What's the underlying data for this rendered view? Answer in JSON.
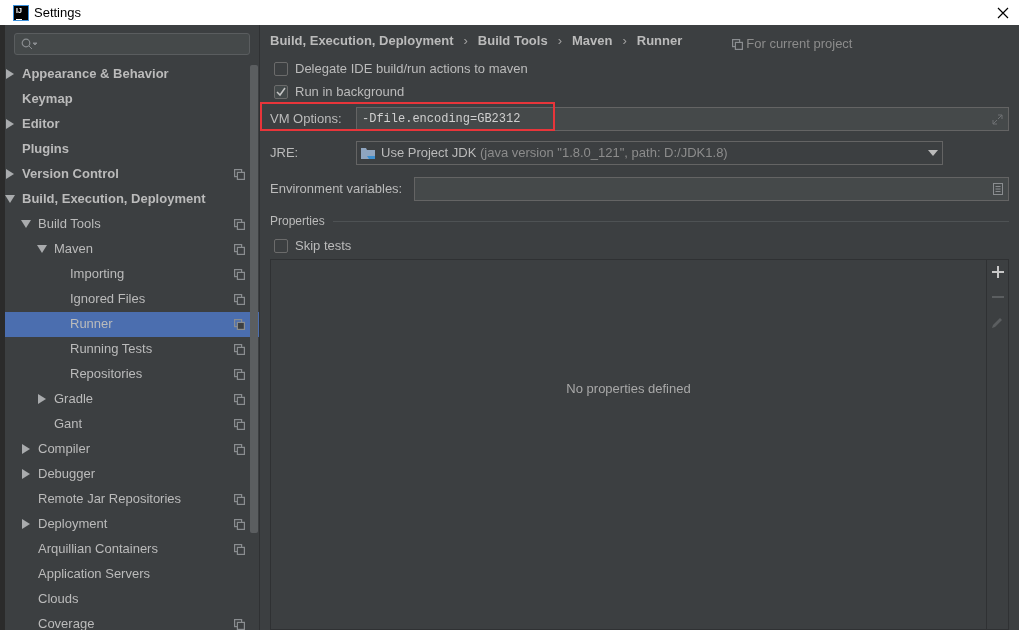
{
  "window": {
    "title": "Settings",
    "logo": "IJ"
  },
  "tree": [
    {
      "label": "Appearance & Behavior",
      "expanded": false,
      "shared": false,
      "selected": false
    },
    {
      "label": "Keymap",
      "shared": false,
      "selected": false
    },
    {
      "label": "Editor",
      "expanded": false,
      "shared": false,
      "selected": false
    },
    {
      "label": "Plugins",
      "shared": false,
      "selected": false
    },
    {
      "label": "Version Control",
      "expanded": false,
      "shared": true,
      "selected": false
    },
    {
      "label": "Build, Execution, Deployment",
      "expanded": true,
      "shared": false,
      "selected": false,
      "children": [
        {
          "label": "Build Tools",
          "expanded": true,
          "shared": true,
          "selected": false,
          "children": [
            {
              "label": "Maven",
              "expanded": true,
              "shared": true,
              "selected": false,
              "children": [
                {
                  "label": "Importing",
                  "shared": true,
                  "selected": false
                },
                {
                  "label": "Ignored Files",
                  "shared": true,
                  "selected": false
                },
                {
                  "label": "Runner",
                  "shared": true,
                  "selected": true
                },
                {
                  "label": "Running Tests",
                  "shared": true,
                  "selected": false
                },
                {
                  "label": "Repositories",
                  "shared": true,
                  "selected": false
                }
              ]
            },
            {
              "label": "Gradle",
              "expanded": false,
              "shared": true,
              "selected": false
            },
            {
              "label": "Gant",
              "shared": true,
              "selected": false
            }
          ]
        },
        {
          "label": "Compiler",
          "expanded": false,
          "shared": true,
          "selected": false
        },
        {
          "label": "Debugger",
          "expanded": false,
          "shared": false,
          "selected": false
        },
        {
          "label": "Remote Jar Repositories",
          "shared": true,
          "selected": false
        },
        {
          "label": "Deployment",
          "expanded": false,
          "shared": true,
          "selected": false
        },
        {
          "label": "Arquillian Containers",
          "shared": true,
          "selected": false
        },
        {
          "label": "Application Servers",
          "shared": false,
          "selected": false
        },
        {
          "label": "Clouds",
          "shared": false,
          "selected": false
        },
        {
          "label": "Coverage",
          "shared": true,
          "selected": false
        }
      ]
    }
  ],
  "breadcrumbs": [
    "Build, Execution, Deployment",
    "Build Tools",
    "Maven",
    "Runner"
  ],
  "breadcrumb_separator": "›",
  "scope": "For current project",
  "options": [
    {
      "label": "Delegate IDE build/run actions to maven",
      "checked": false
    },
    {
      "label": "Run in background",
      "checked": true
    }
  ],
  "vm_options": {
    "label": "VM Options:",
    "value": "-Dfile.encoding=GB2312",
    "highlighted": true
  },
  "jre": {
    "label": "JRE:",
    "value": "Use Project JDK",
    "detail": "(java version \"1.8.0_121\", path: D:/JDK1.8)"
  },
  "env": {
    "label": "Environment variables:"
  },
  "properties": {
    "title": "Properties",
    "skip_tests": {
      "label": "Skip tests",
      "checked": false
    },
    "empty_text": "No properties defined",
    "toolbar": [
      {
        "kind": "add",
        "disabled": false
      },
      {
        "kind": "remove",
        "disabled": true
      },
      {
        "kind": "edit",
        "disabled": true
      }
    ]
  }
}
